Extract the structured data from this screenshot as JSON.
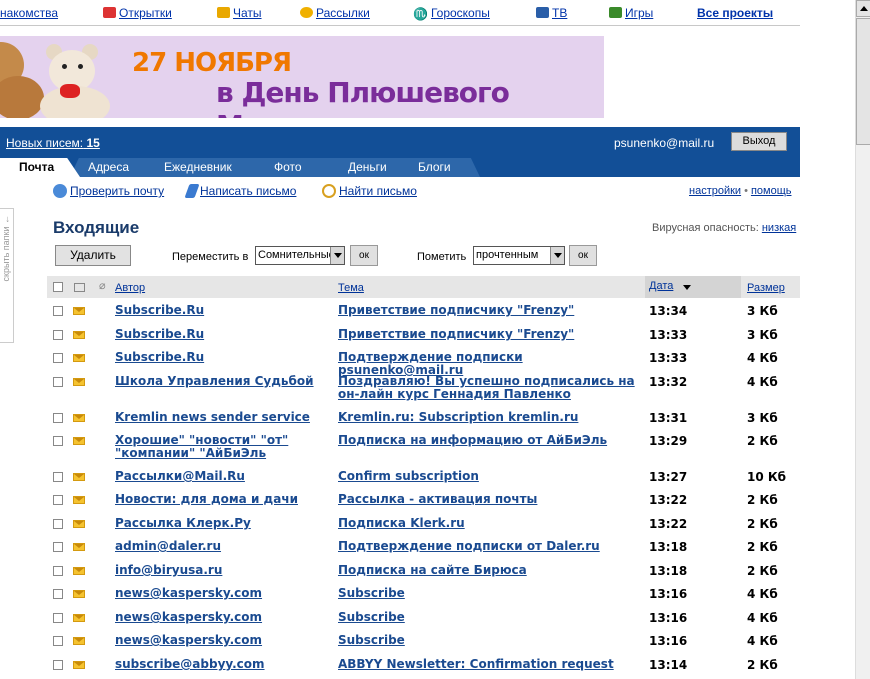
{
  "topnav": {
    "items": [
      {
        "label": "накомства",
        "icon": "none"
      },
      {
        "label": "Открытки",
        "icon": "postcard-icon"
      },
      {
        "label": "Чаты",
        "icon": "chat-icon"
      },
      {
        "label": "Рассылки",
        "icon": "newsletter-icon"
      },
      {
        "label": "Гороскопы",
        "icon": "horoscope-icon"
      },
      {
        "label": "ТВ",
        "icon": "tv-icon"
      },
      {
        "label": "Игры",
        "icon": "games-icon"
      }
    ],
    "all_projects": "Все проекты"
  },
  "banner": {
    "line1": "27 НОЯБРЯ",
    "line2": "в День Плюшевого Мишки"
  },
  "header": {
    "new_mail_label": "Новых писем:",
    "new_mail_count": "15",
    "email": "psunenko@mail.ru",
    "exit_label": "Выход"
  },
  "tabs": [
    "Почта",
    "Адреса",
    "Ежедневник",
    "Фото",
    "Деньги",
    "Блоги"
  ],
  "actions": {
    "check_mail": "Проверить почту",
    "write_mail": "Написать письмо",
    "find_mail": "Найти письмо",
    "settings": "настройки",
    "separator": "•",
    "help": "помощь"
  },
  "sidebar": {
    "hide_folders": "скрыть папки ←"
  },
  "inbox": {
    "title": "Входящие",
    "virus_label": "Вирусная опасность:",
    "virus_level": "низкая",
    "delete_label": "Удалить",
    "move_label": "Переместить в",
    "move_select": "Сомнительные",
    "ok_label": "ок",
    "mark_label": "Пометить",
    "mark_select": "прочтенным"
  },
  "table": {
    "columns": {
      "author": "Автор",
      "subject": "Тема",
      "date": "Дата",
      "size": "Размер"
    },
    "rows": [
      {
        "author": "Subscribe.Ru",
        "subject": "Приветствие подписчику \"Frenzy\"",
        "date": "13:34",
        "size": "3 Кб"
      },
      {
        "author": "Subscribe.Ru",
        "subject": "Приветствие подписчику \"Frenzy\"",
        "date": "13:33",
        "size": "3 Кб"
      },
      {
        "author": "Subscribe.Ru",
        "subject": "Подтверждение подписки psunenko@mail.ru",
        "date": "13:33",
        "size": "4 Кб"
      },
      {
        "author": "Школа Управления Судьбой",
        "subject": "Поздравляю! Вы успешно подписались на он-лайн курс Геннадия Павленко",
        "date": "13:32",
        "size": "4 Кб"
      },
      {
        "author": "Kremlin news sender service",
        "subject": "Kremlin.ru: Subscription kremlin.ru",
        "date": "13:31",
        "size": "3 Кб"
      },
      {
        "author": "Хорошие\" \"новости\" \"от\" \"компании\" \"АйБиЭль",
        "subject": "Подписка на информацию от АйБиЭль",
        "date": "13:29",
        "size": "2 Кб"
      },
      {
        "author": "Рассылки@Mail.Ru",
        "subject": "Confirm subscription",
        "date": "13:27",
        "size": "10 Кб"
      },
      {
        "author": "Новости: для дома и дачи",
        "subject": "Рассылка - активация почты",
        "date": "13:22",
        "size": "2 Кб"
      },
      {
        "author": "Рассылка Клерк.Ру",
        "subject": "Подписка Klerk.ru",
        "date": "13:22",
        "size": "2 Кб"
      },
      {
        "author": "admin@daler.ru",
        "subject": "Подтверждение подписки от Daler.ru",
        "date": "13:18",
        "size": "2 Кб"
      },
      {
        "author": "info@biryusa.ru",
        "subject": "Подписка на сайте Бирюса",
        "date": "13:18",
        "size": "2 Кб"
      },
      {
        "author": "news@kaspersky.com",
        "subject": "Subscribe",
        "date": "13:16",
        "size": "4 Кб"
      },
      {
        "author": "news@kaspersky.com",
        "subject": "Subscribe",
        "date": "13:16",
        "size": "4 Кб"
      },
      {
        "author": "news@kaspersky.com",
        "subject": "Subscribe",
        "date": "13:16",
        "size": "4 Кб"
      },
      {
        "author": "subscribe@abbyy.com",
        "subject": "ABBYY Newsletter: Confirmation request",
        "date": "13:14",
        "size": "2 Кб"
      }
    ]
  },
  "colors": {
    "header_blue": "#124f97",
    "link": "#003399",
    "unread_envelope": "#f5c330",
    "banner_orange": "#f07800",
    "banner_purple": "#7a2d9a"
  }
}
